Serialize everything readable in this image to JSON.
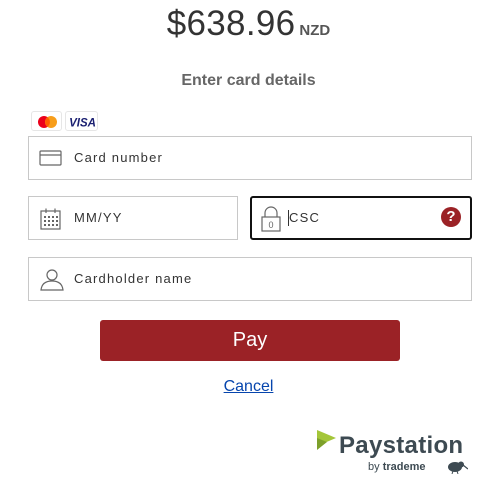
{
  "payment": {
    "amount": "$638.96",
    "currency": "NZD",
    "subtitle": "Enter card details"
  },
  "brands": [
    {
      "name": "Mastercard",
      "icon": "mastercard-icon"
    },
    {
      "name": "VISA",
      "icon": "visa-icon"
    }
  ],
  "fields": {
    "card_number": {
      "placeholder": "Card number",
      "icon": "card-icon"
    },
    "expiry": {
      "placeholder": "MM/YY",
      "icon": "calendar-icon"
    },
    "csc": {
      "placeholder": "CSC",
      "icon": "lock-icon",
      "help": "?"
    },
    "cardholder": {
      "placeholder": "Cardholder name",
      "icon": "user-icon"
    }
  },
  "actions": {
    "pay_label": "Pay",
    "cancel_label": "Cancel"
  },
  "footer": {
    "brand": "Paystation",
    "by": "by",
    "partner": "trademe"
  },
  "colors": {
    "accent": "#9b2226",
    "logo_green": "#a4c639",
    "link": "#0645ad",
    "visa_blue": "#1a1f71"
  }
}
